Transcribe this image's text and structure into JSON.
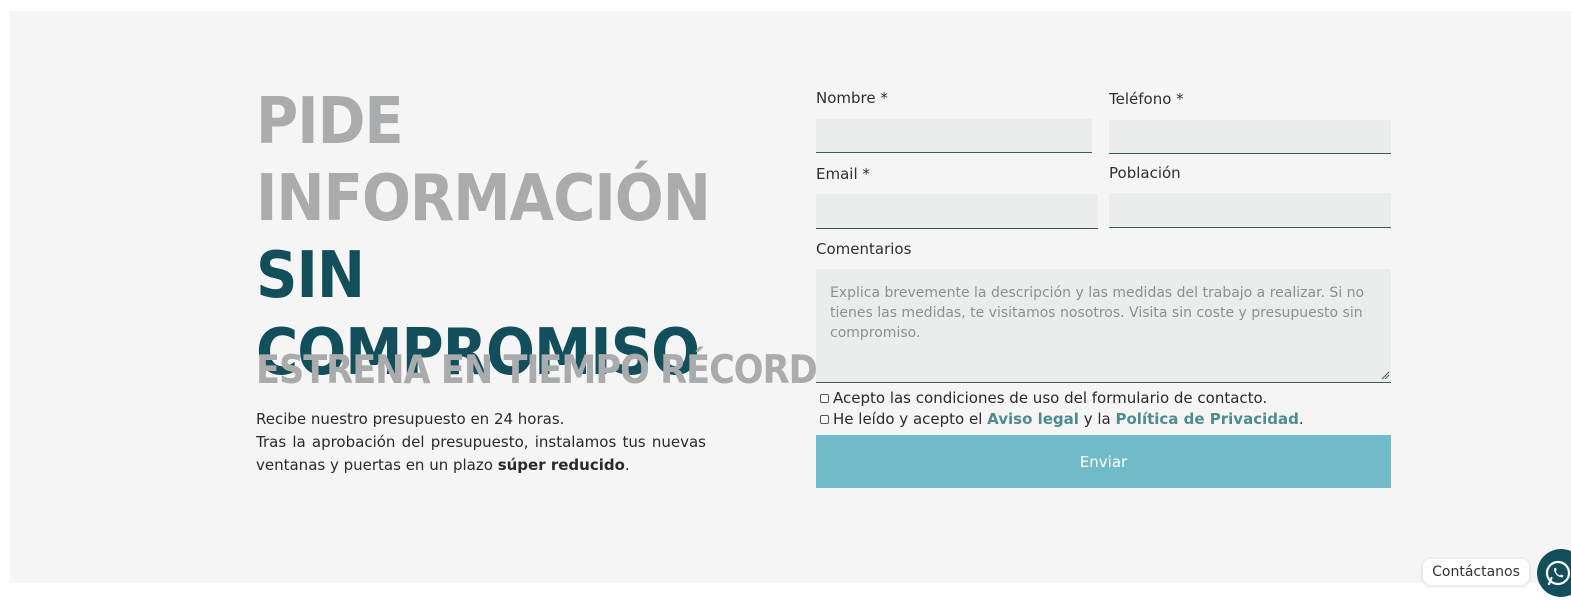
{
  "headline": {
    "line1": "PIDE",
    "line2_grey": "INFORMACIÓN",
    "line2_teal": "SIN",
    "line3": "COMPROMISO"
  },
  "subheadline": "ESTRENA EN TIEMPO RÉCORD",
  "copy": {
    "line1": "Recibe nuestro presupuesto en 24 horas.",
    "line2": "Tras la aprobación del presupuesto, instalamos tus nuevas ventanas y puertas en un plazo",
    "bold": "súper reducido",
    "end": "."
  },
  "form": {
    "nombre_label": "Nombre *",
    "nombre_value": "",
    "telefono_label": "Teléfono *",
    "telefono_value": "",
    "email_label": "Email *",
    "email_value": "",
    "poblacion_label": "Población",
    "poblacion_value": "",
    "comentarios_label": "Comentarios",
    "comentarios_placeholder": "Explica brevemente la descripción y las medidas del trabajo a realizar. Si no tienes las medidas, te visitamos nosotros. Visita sin coste y presupuesto sin compromiso.",
    "acepto_condiciones": "Acepto las condiciones de uso del formulario de contacto.",
    "acepto_legal_prefix": "He leído y acepto el",
    "aviso_legal_link": "Aviso legal",
    "acepto_legal_middle": "y la",
    "privacidad_link": "Política de Privacidad",
    "acepto_legal_end": ".",
    "submit_label": "Enviar"
  },
  "contact_widget": {
    "label": "Contáctanos",
    "icon": "whatsapp-icon"
  },
  "colors": {
    "background": "#f5f5f5",
    "headline_grey": "#a9abad",
    "headline_teal": "#134f5a",
    "link": "#4f8b8f",
    "submit_button": "#70bbc8",
    "field_background": "#ebecec"
  }
}
